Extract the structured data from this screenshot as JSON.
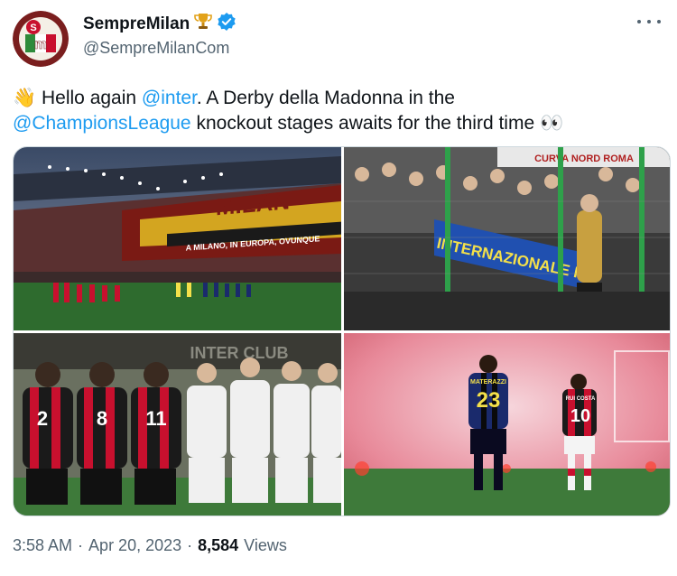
{
  "account": {
    "display_name": "SempreMilan",
    "handle": "@SempreMilanCom",
    "avatar_letters": "S M"
  },
  "tweet": {
    "part1": "Hello again ",
    "mention1": "@inter",
    "part2": ". A Derby della Madonna in the ",
    "mention2": "@ChampionsLeague",
    "part3": " knockout stages awaits for the third time "
  },
  "photos": {
    "p1_banner_main": "MILAN",
    "p1_banner_sub": "A MILANO, IN EUROPA, OVUNQUE",
    "p2_banner": "INTERNAZIONALE FC",
    "p2_top_banner": "CURVA NORD ROMA",
    "p3_wall": "INTER CLUB",
    "p3_numbers": [
      "2",
      "8",
      "11"
    ],
    "p4_player1_name": "MATERAZZI",
    "p4_player1_number": "23",
    "p4_player2_name": "RUI COSTA",
    "p4_player2_number": "10"
  },
  "meta": {
    "time": "3:58 AM",
    "sep1": "·",
    "date": "Apr 20, 2023",
    "sep2": "·",
    "views": "8,584",
    "views_label": "Views"
  },
  "colors": {
    "link": "#1d9bf0",
    "verified": "#1d9bf0",
    "secondary_text": "#536471",
    "milan_red": "#c8102e",
    "inter_blue": "#1a2a6c"
  },
  "icons": {
    "waving_hand": "👋",
    "eyes": "👀",
    "trophy": "trophy-icon",
    "verified": "verified-badge-icon",
    "more": "more-icon"
  }
}
